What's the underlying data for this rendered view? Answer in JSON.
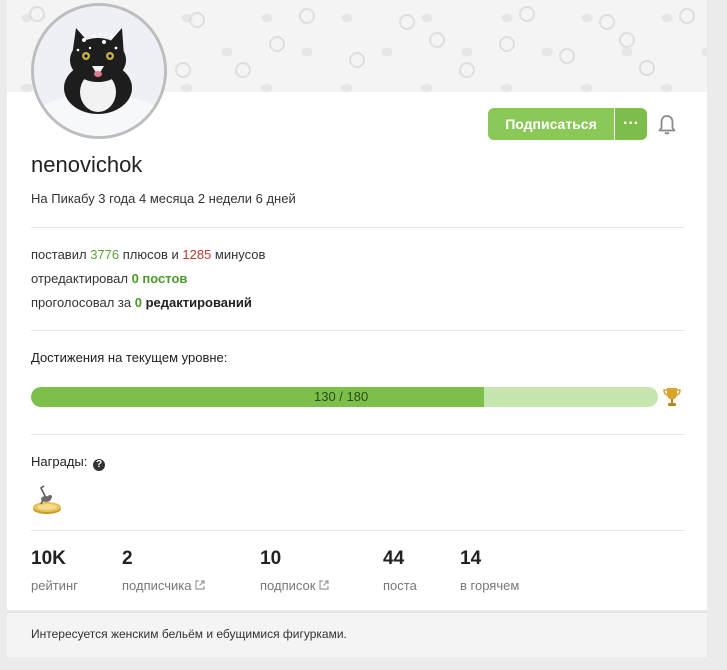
{
  "profile": {
    "username": "nenovichok",
    "since": "На Пикабу 3 года 4 месяца 2 недели 6 дней"
  },
  "actions": {
    "subscribe_label": "Подписаться",
    "more_label": "···"
  },
  "activity": {
    "line1_prefix": "поставил ",
    "plus_count": "3776",
    "line1_mid": " плюсов и ",
    "minus_count": "1285",
    "line1_suffix": " минусов",
    "line2_prefix": "отредактировал ",
    "edited_posts": "0 постов",
    "line3_prefix": "проголосовал за ",
    "voted_count": "0",
    "line3_suffix": " редактирований"
  },
  "achievements": {
    "title": "Достижения на текущем уровне:",
    "progress_text": "130 / 180",
    "current": 130,
    "total": 180
  },
  "awards": {
    "title": "Награды:",
    "help_glyph": "?"
  },
  "stats": [
    {
      "value": "10K",
      "label": "рейтинг",
      "link": false
    },
    {
      "value": "2",
      "label": "подписчика",
      "link": true
    },
    {
      "value": "10",
      "label": "подписок",
      "link": true
    },
    {
      "value": "44",
      "label": "поста",
      "link": false
    },
    {
      "value": "14",
      "label": "в горячем",
      "link": false
    }
  ],
  "footer": {
    "about": "Интересуется женским бельём и ебущимися фигурками."
  },
  "colors": {
    "accent": "#8ac858",
    "accent_dark": "#7dbd4c",
    "plus": "#5ea33b",
    "minus": "#c0392b"
  },
  "icons": {
    "bell": "bell-icon",
    "trophy": "trophy-icon",
    "help": "question-circle-icon",
    "external": "external-link-icon"
  }
}
